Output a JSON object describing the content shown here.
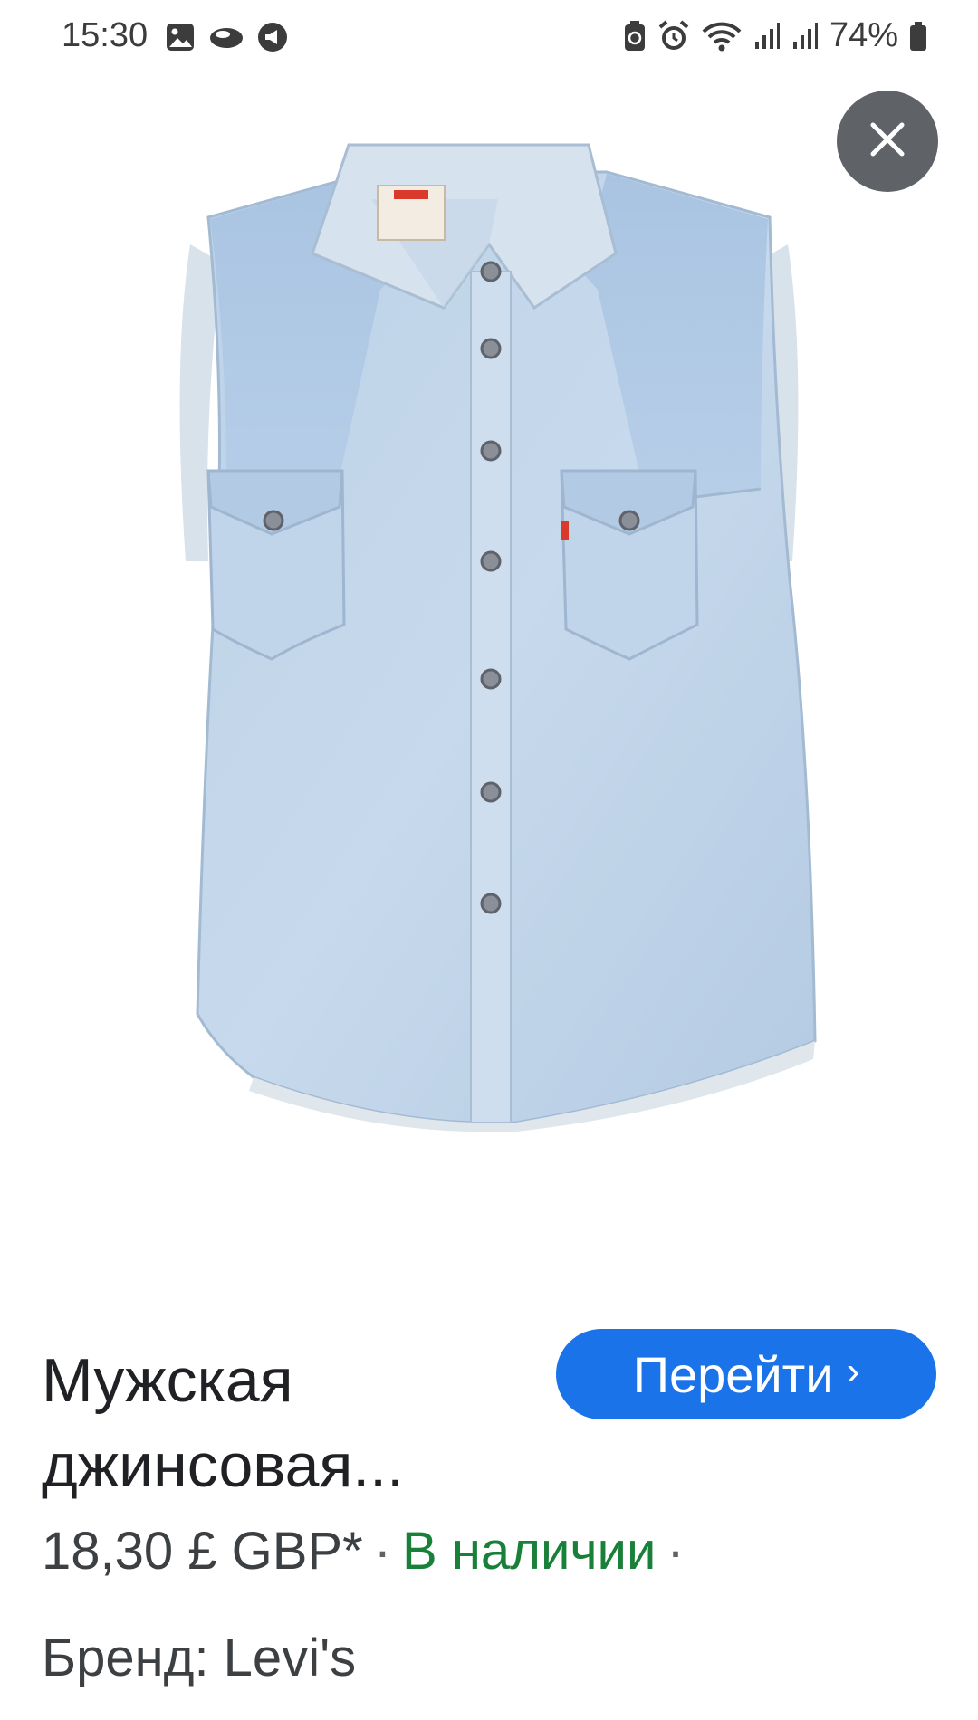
{
  "status_bar": {
    "time": "15:30",
    "battery_percent": "74%",
    "left_icons": [
      "gallery-icon",
      "cloud-icon",
      "megaphone-icon"
    ],
    "right_icons": [
      "battery-saver-icon",
      "alarm-icon",
      "wifi-icon",
      "signal-icon",
      "signal-icon",
      "battery-icon"
    ]
  },
  "close_button": {
    "icon": "close-icon"
  },
  "product": {
    "image_icon": "denim-shirt-image",
    "title_line1": "Мужская",
    "title_line2": "джинсовая...",
    "goto_label": "Перейти",
    "goto_chevron": "›",
    "price": "18,30 £ GBP*",
    "separator": "·",
    "stock": "В наличии",
    "trailing_separator": "·",
    "brand": "Бренд: Levi's"
  },
  "colors": {
    "accent_blue": "#1a73e8",
    "stock_green": "#188038",
    "close_bg": "#5f6368"
  }
}
